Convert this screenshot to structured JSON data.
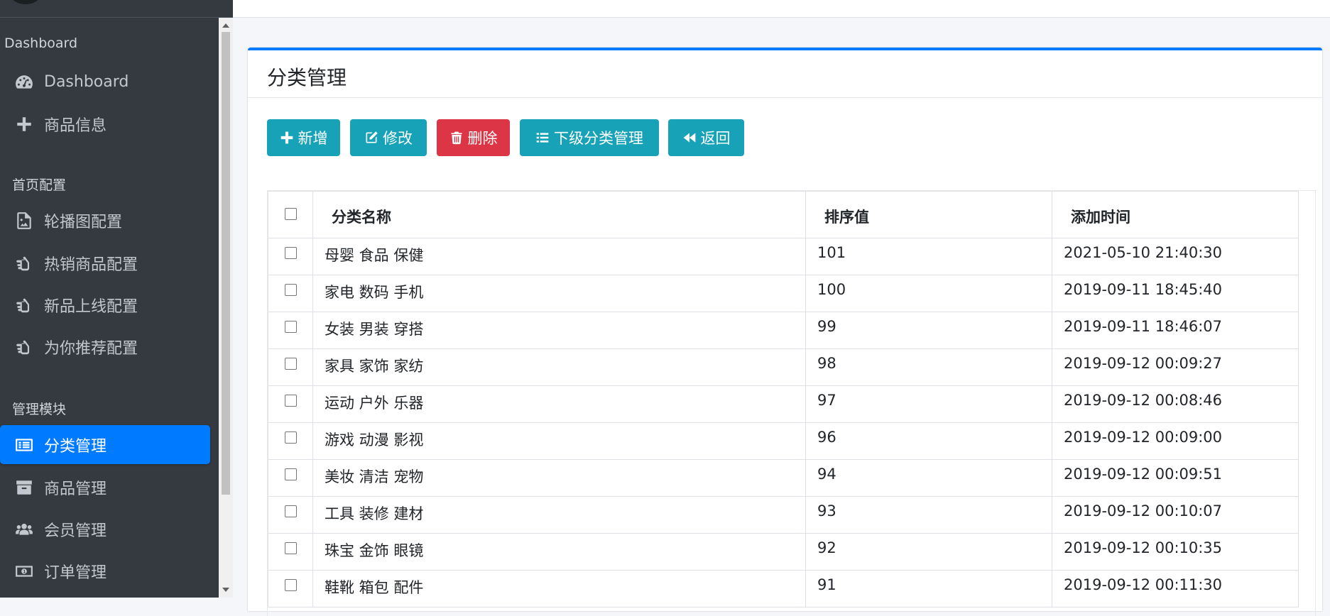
{
  "sidebar": {
    "sections": [
      {
        "header": "Dashboard",
        "items": [
          {
            "label": "Dashboard",
            "icon": "tachometer-icon"
          },
          {
            "label": "商品信息",
            "icon": "plus-icon"
          }
        ]
      },
      {
        "header": "首页配置",
        "items": [
          {
            "label": "轮播图配置",
            "icon": "image-file-icon"
          },
          {
            "label": "热销商品配置",
            "icon": "hand-pointer-icon"
          },
          {
            "label": "新品上线配置",
            "icon": "hand-pointer-icon"
          },
          {
            "label": "为你推荐配置",
            "icon": "hand-pointer-icon"
          }
        ]
      },
      {
        "header": "管理模块",
        "items": [
          {
            "label": "分类管理",
            "icon": "list-alt-icon",
            "active": true
          },
          {
            "label": "商品管理",
            "icon": "archive-icon"
          },
          {
            "label": "会员管理",
            "icon": "users-icon"
          },
          {
            "label": "订单管理",
            "icon": "money-bill-icon"
          }
        ]
      }
    ]
  },
  "card": {
    "title": "分类管理",
    "buttons": {
      "add": "新增",
      "edit": "修改",
      "delete": "删除",
      "sub": "下级分类管理",
      "back": "返回"
    }
  },
  "table": {
    "columns": [
      "分类名称",
      "排序值",
      "添加时间"
    ],
    "rows": [
      {
        "name": "母婴 食品 保健",
        "rank": "101",
        "time": "2021-05-10 21:40:30"
      },
      {
        "name": "家电 数码 手机",
        "rank": "100",
        "time": "2019-09-11 18:45:40"
      },
      {
        "name": "女装 男装 穿搭",
        "rank": "99",
        "time": "2019-09-11 18:46:07"
      },
      {
        "name": "家具 家饰 家纺",
        "rank": "98",
        "time": "2019-09-12 00:09:27"
      },
      {
        "name": "运动 户外 乐器",
        "rank": "97",
        "time": "2019-09-12 00:08:46"
      },
      {
        "name": "游戏 动漫 影视",
        "rank": "96",
        "time": "2019-09-12 00:09:00"
      },
      {
        "name": "美妆 清洁 宠物",
        "rank": "94",
        "time": "2019-09-12 00:09:51"
      },
      {
        "name": "工具 装修 建材",
        "rank": "93",
        "time": "2019-09-12 00:10:07"
      },
      {
        "name": "珠宝 金饰 眼镜",
        "rank": "92",
        "time": "2019-09-12 00:10:35"
      },
      {
        "name": "鞋靴 箱包 配件",
        "rank": "91",
        "time": "2019-09-12 00:11:30"
      }
    ]
  },
  "colors": {
    "sidebar_bg": "#343a40",
    "active_item": "#007bff",
    "btn_info": "#17a2b8",
    "btn_danger": "#dc3545"
  }
}
